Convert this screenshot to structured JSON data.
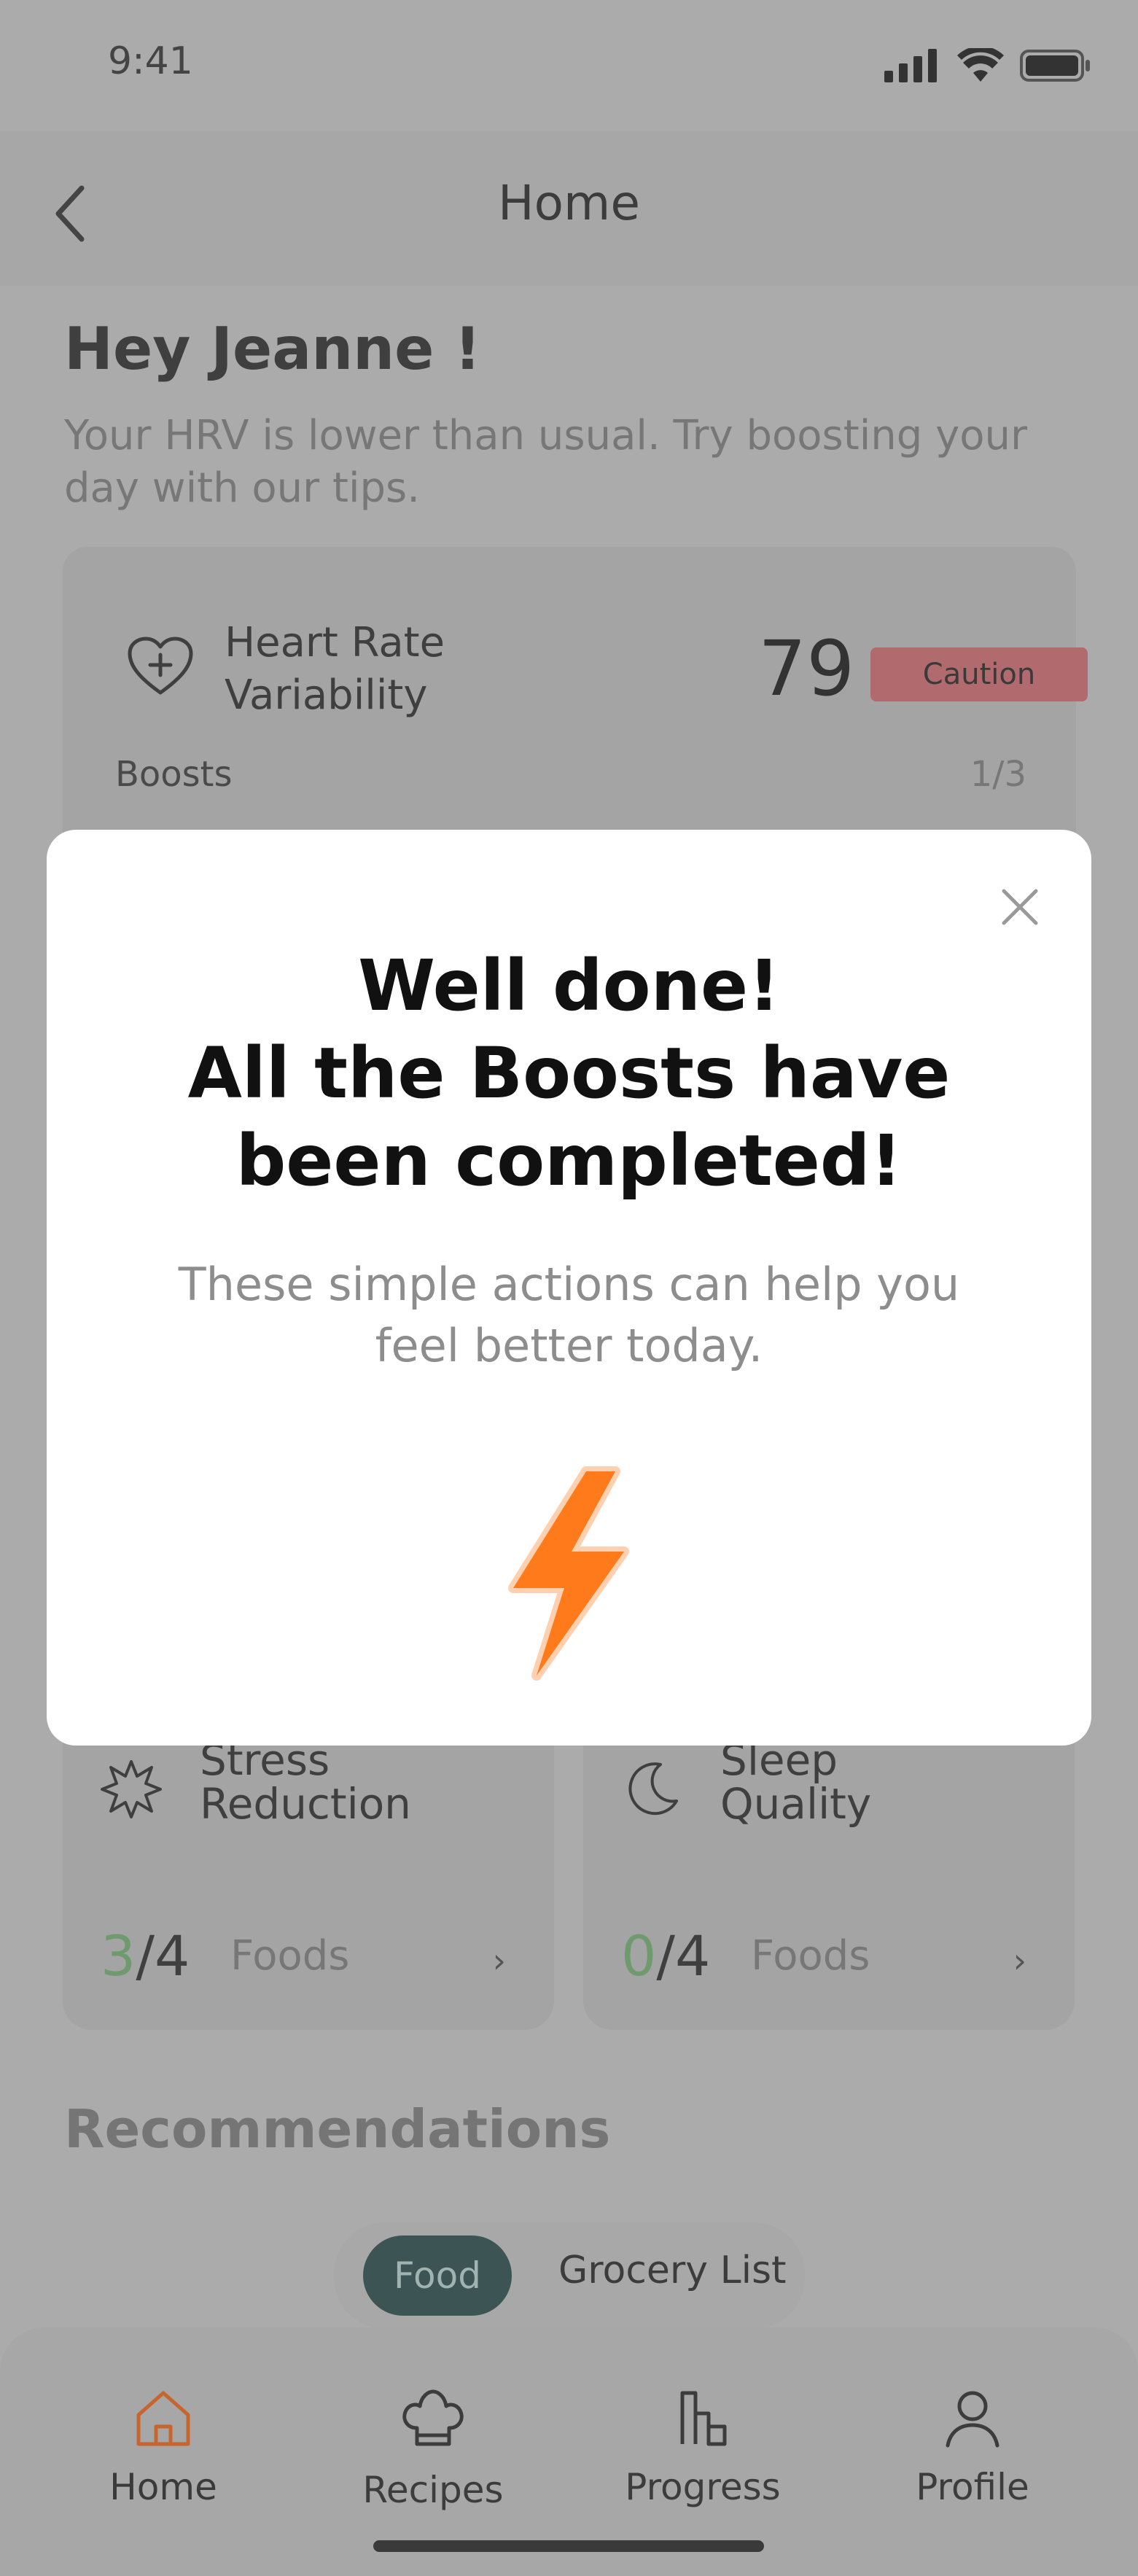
{
  "status": {
    "time": "9:41"
  },
  "header": {
    "title": "Home"
  },
  "greeting": {
    "title": "Hey Jeanne !",
    "subtitle": "Your HRV is lower than usual. Try boosting your day with our tips."
  },
  "hrv": {
    "title_line1": "Heart Rate",
    "title_line2": "Variability",
    "value": "79",
    "badge": "Caution",
    "boosts_label": "Boosts",
    "boosts_count": "1/3"
  },
  "stats": [
    {
      "title_line1": "Stress",
      "title_line2": "Reduction",
      "done": "3",
      "total": "/4",
      "unit": "Foods",
      "chevron": "›"
    },
    {
      "title_line1": "Sleep",
      "title_line2": "Quality",
      "done": "0",
      "total": "/4",
      "unit": "Foods",
      "chevron": "›"
    }
  ],
  "recommendations": {
    "title": "Recommendations",
    "tabs": [
      "Food",
      "Grocery List"
    ]
  },
  "tabbar": {
    "items": [
      "Home",
      "Recipes",
      "Progress",
      "Profile"
    ],
    "active": "Home",
    "active_color": "#c7652f"
  },
  "modal": {
    "title_line1": "Well done!",
    "title_line2": "All the Boosts have",
    "title_line3": "been completed!",
    "body": "These simple actions can help you feel better today.",
    "icon": "lightning-bolt-icon",
    "icon_color": "#ff7a1a"
  }
}
